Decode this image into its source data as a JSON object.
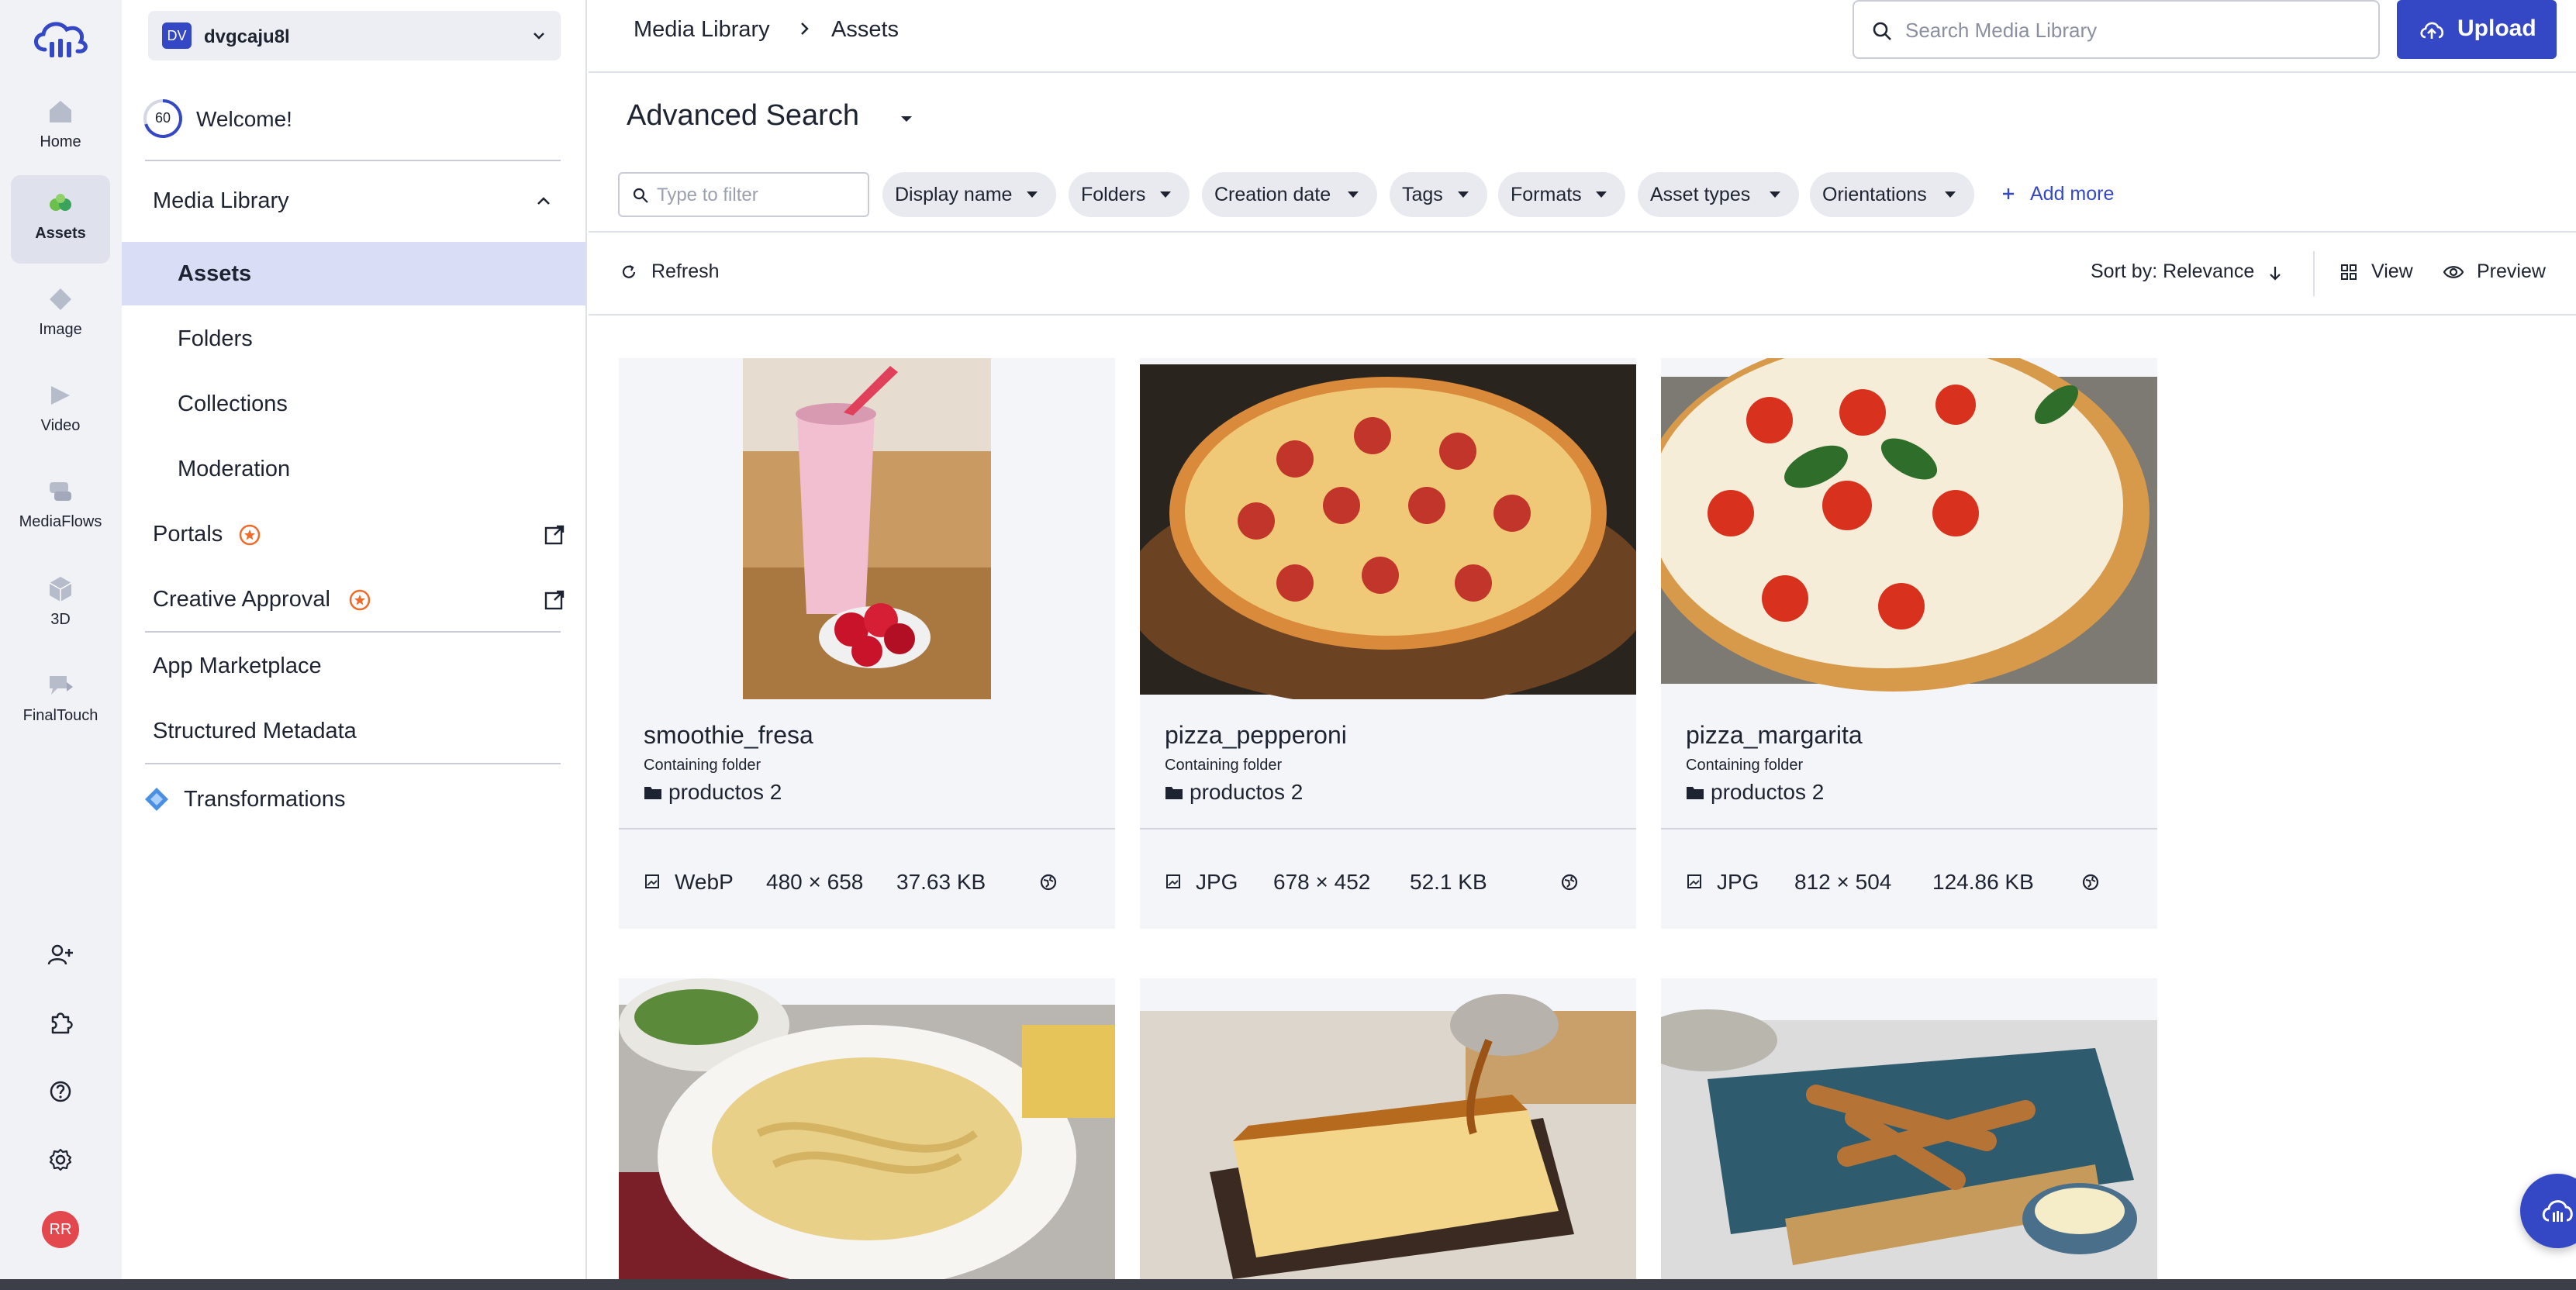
{
  "colors": {
    "accent": "#3448c5",
    "active_bg": "#d9ddf5",
    "avatar": "#e2484e",
    "star": "#f06a2a"
  },
  "rail": {
    "items": [
      {
        "label": "Home",
        "icon": "home-icon"
      },
      {
        "label": "Assets",
        "icon": "assets-icon"
      },
      {
        "label": "Image",
        "icon": "image-icon"
      },
      {
        "label": "Video",
        "icon": "video-icon"
      },
      {
        "label": "MediaFlows",
        "icon": "mediaflows-icon"
      },
      {
        "label": "3D",
        "icon": "3d-icon"
      },
      {
        "label": "FinalTouch",
        "icon": "finaltouch-icon"
      }
    ],
    "active": "Assets",
    "avatar_initials": "RR"
  },
  "sidebar": {
    "account_badge": "DV",
    "account_name": "dvgcaju8l",
    "welcome_progress": "60",
    "welcome_label": "Welcome!",
    "media_library": "Media Library",
    "sub_items": [
      "Assets",
      "Folders",
      "Collections",
      "Moderation"
    ],
    "portals": "Portals",
    "creative_approval": "Creative Approval",
    "app_marketplace": "App Marketplace",
    "structured_metadata": "Structured Metadata",
    "transformations": "Transformations"
  },
  "header": {
    "crumb_1": "Media Library",
    "crumb_2": "Assets",
    "search_placeholder": "Search Media Library",
    "upload_label": "Upload"
  },
  "search": {
    "title": "Advanced Search",
    "filter_placeholder": "Type to filter",
    "chips": [
      "Display name",
      "Folders",
      "Creation date",
      "Tags",
      "Formats",
      "Asset types",
      "Orientations"
    ],
    "add_more": "Add more"
  },
  "toolbar": {
    "refresh": "Refresh",
    "sort_by": "Sort by: Relevance",
    "view": "View",
    "preview": "Preview"
  },
  "assets": [
    {
      "name": "smoothie_fresa",
      "folder_label": "Containing folder",
      "folder": "productos 2",
      "format": "WebP",
      "dims": "480 × 658",
      "size": "37.63 KB"
    },
    {
      "name": "pizza_pepperoni",
      "folder_label": "Containing folder",
      "folder": "productos 2",
      "format": "JPG",
      "dims": "678 × 452",
      "size": "52.1 KB"
    },
    {
      "name": "pizza_margarita",
      "folder_label": "Containing folder",
      "folder": "productos 2",
      "format": "JPG",
      "dims": "812 × 504",
      "size": "124.86 KB"
    },
    {
      "name": "",
      "folder_label": "",
      "folder": "",
      "format": "",
      "dims": "",
      "size": ""
    },
    {
      "name": "",
      "folder_label": "",
      "folder": "",
      "format": "",
      "dims": "",
      "size": ""
    },
    {
      "name": "",
      "folder_label": "",
      "folder": "",
      "format": "",
      "dims": "",
      "size": ""
    }
  ]
}
